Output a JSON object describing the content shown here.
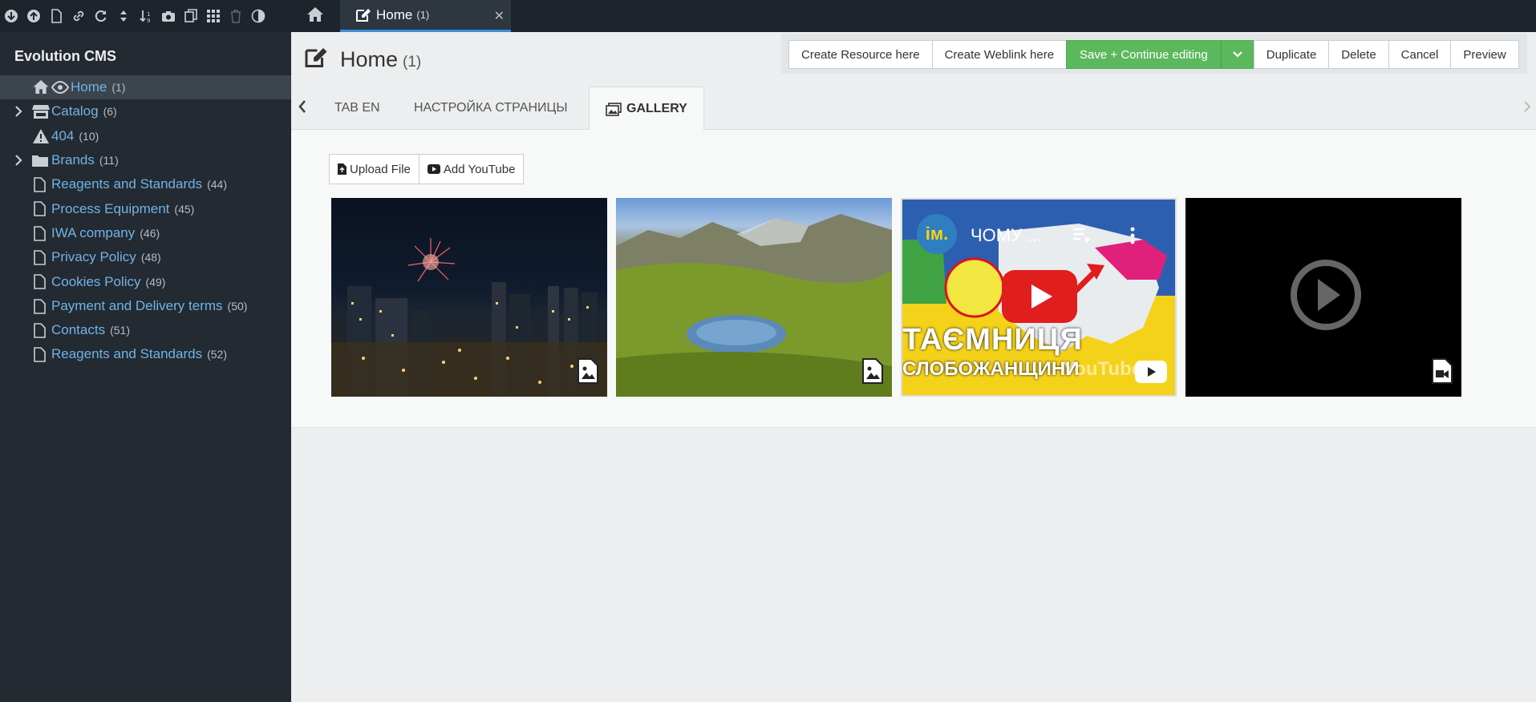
{
  "colors": {
    "accent": "#3b8fd9",
    "link": "#6fb3e8",
    "success": "#5cb85c",
    "sidebar_bg": "#242a31",
    "topbar_bg": "#1e242b"
  },
  "toolbar": {
    "icons": [
      "new-resource-icon",
      "upload-icon",
      "new-document-icon",
      "weblink-icon",
      "refresh-icon",
      "collapse-icon",
      "sort-icon",
      "snapshot-icon",
      "copy-icon",
      "grid-icon",
      "trash-icon",
      "contrast-icon"
    ]
  },
  "tabs_bar": {
    "home_icon": "home-icon",
    "active_tab": {
      "label": "Home",
      "count": "(1)",
      "close": "✕"
    }
  },
  "sidebar": {
    "title": "Evolution CMS",
    "items": [
      {
        "label": "Home",
        "count": "(1)"
      },
      {
        "label": "Catalog",
        "count": "(6)"
      },
      {
        "label": "404",
        "count": "(10)"
      },
      {
        "label": "Brands",
        "count": "(11)"
      },
      {
        "label": "Reagents and Standards",
        "count": "(44)"
      },
      {
        "label": "Process Equipment",
        "count": "(45)"
      },
      {
        "label": "IWA company",
        "count": "(46)"
      },
      {
        "label": "Privacy Policy",
        "count": "(48)"
      },
      {
        "label": "Cookies Policy",
        "count": "(49)"
      },
      {
        "label": "Payment and Delivery terms",
        "count": "(50)"
      },
      {
        "label": "Contacts",
        "count": "(51)"
      },
      {
        "label": "Reagents and Standards",
        "count": "(52)"
      }
    ]
  },
  "main": {
    "title": "Home",
    "title_count": "(1)",
    "actions": {
      "create_resource": "Create Resource here",
      "create_weblink": "Create Weblink here",
      "save": "Save + Continue editing",
      "duplicate": "Duplicate",
      "delete": "Delete",
      "cancel": "Cancel",
      "preview": "Preview"
    },
    "tabs": [
      {
        "label": "TAB EN"
      },
      {
        "label": "НАСТРОЙКА СТРАНИЦЫ"
      },
      {
        "label": "GALLERY"
      }
    ],
    "gallery": {
      "upload_label": "Upload File",
      "youtube_label": "Add YouTube",
      "yt_channel": "ім.",
      "yt_title": "ЧОМУ ...",
      "yt_banner1": "ТАЄМНИЦЯ",
      "yt_banner2": "СЛОБОЖАНЩИНИ",
      "yt_brand": "YouTube"
    }
  }
}
